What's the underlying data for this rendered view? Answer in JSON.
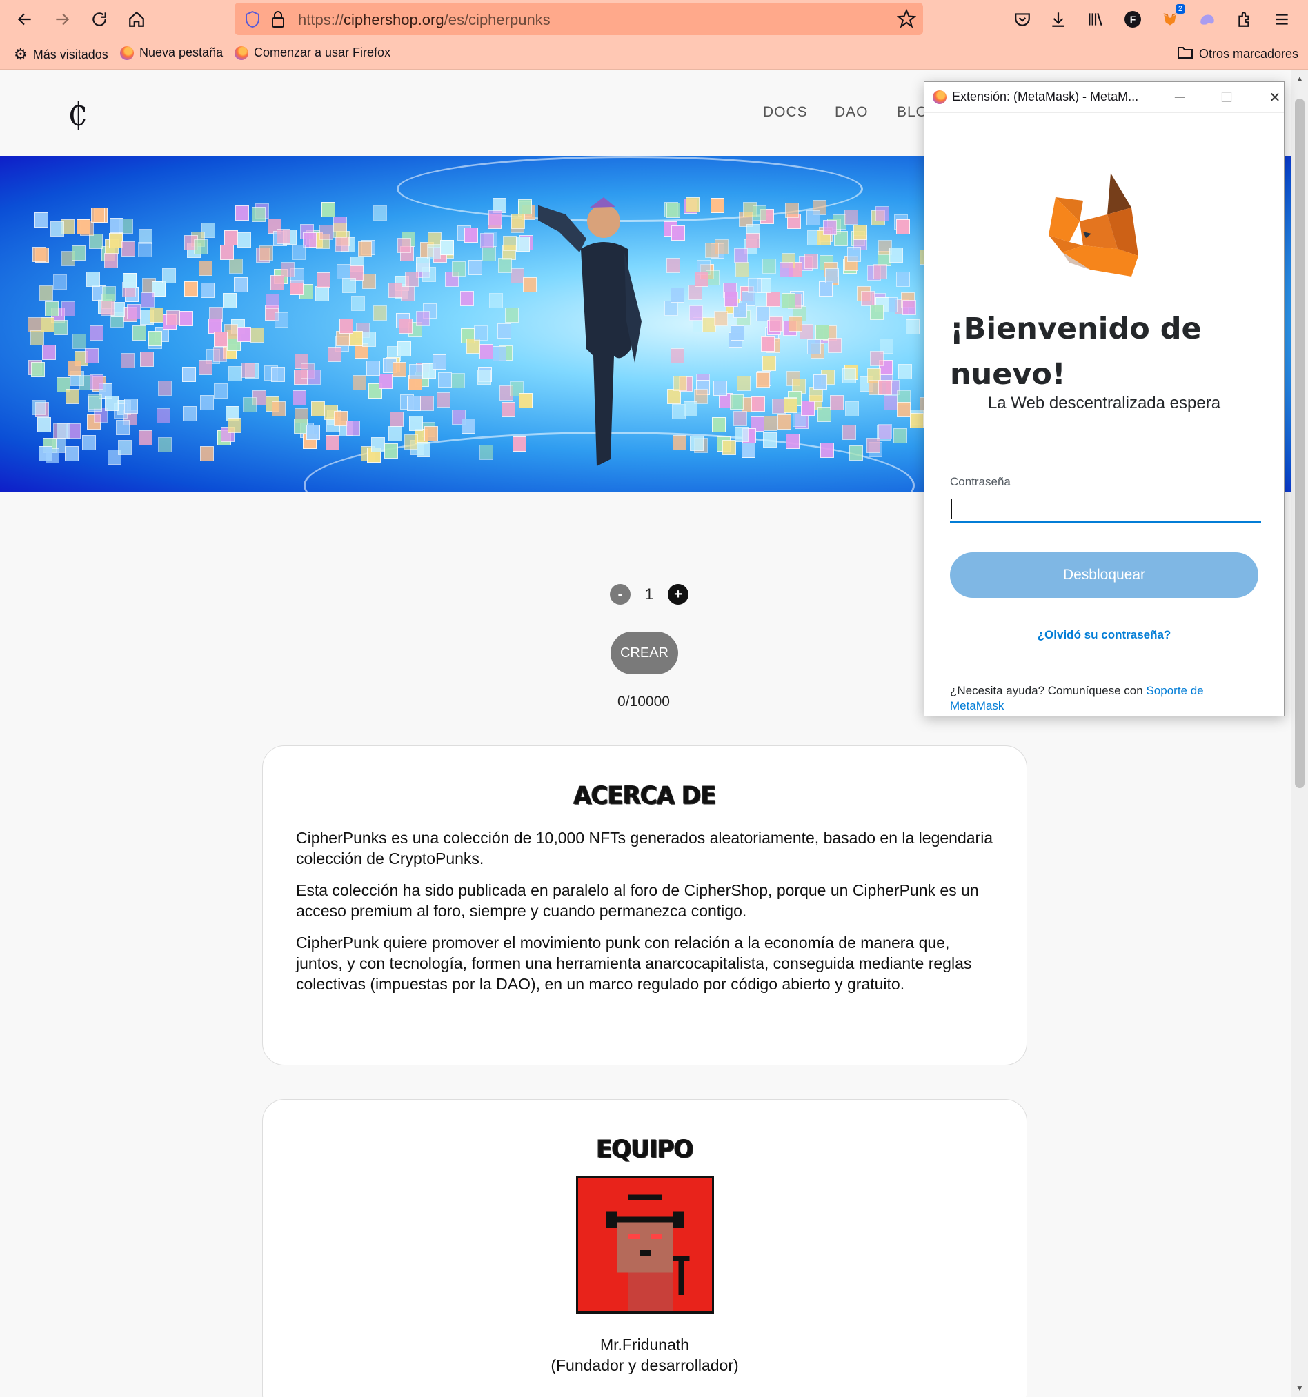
{
  "browser": {
    "url_prefix": "https://",
    "url_domain": "ciphershop.org",
    "url_path": "/es/cipherpunks",
    "extension_badge": "2",
    "account_initial": "F",
    "bookmarks": [
      {
        "label": "Más visitados",
        "icon": "gear-icon"
      },
      {
        "label": "Nueva pestaña",
        "icon": "firefox-icon"
      },
      {
        "label": "Comenzar a usar Firefox",
        "icon": "firefox-icon"
      }
    ],
    "other_bookmarks": "Otros marcadores"
  },
  "site": {
    "logo": "₵",
    "nav": [
      "DOCS",
      "DAO",
      "BLO"
    ]
  },
  "mint": {
    "minus": "-",
    "plus": "+",
    "quantity": "1",
    "button": "CREAR",
    "supply": "0/10000"
  },
  "about": {
    "title": "ACERCA DE",
    "paragraphs": [
      "CipherPunks es una colección de 10,000 NFTs generados aleatoriamente, basado en la legendaria colección de CryptoPunks.",
      "Esta colección ha sido publicada en paralelo al foro de CipherShop, porque un CipherPunk es un acceso premium al foro, siempre y cuando permanezca contigo.",
      "CipherPunk quiere promover el movimiento punk con relación a la economía de manera que, juntos, y con tecnología, formen una herramienta anarcocapitalista, conseguida mediante reglas colectivas (impuestas por la DAO), en un marco regulado por código abierto y gratuito."
    ]
  },
  "team": {
    "title": "EQUIPO",
    "member_name": "Mr.Fridunath",
    "member_role": "(Fundador y desarrollador)"
  },
  "metamask": {
    "window_title": "Extensión: (MetaMask) - MetaM...",
    "heading_line1": "¡Bienvenido de",
    "heading_line2": "nuevo!",
    "subtitle": "La Web descentralizada espera",
    "password_label": "Contraseña",
    "password_value": "",
    "unlock_button": "Desbloquear",
    "forgot_link": "¿Olvidó su contraseña?",
    "help_text": "¿Necesita ayuda? Comuníquese con ",
    "help_link": "Soporte de MetaMask"
  },
  "colors": {
    "toolbar": "#ffc8b4",
    "urlbar": "#ffa98b",
    "metamask_blue": "#037dd6",
    "unlock_disabled": "#7fb7e4",
    "avatar_bg": "#e8231b"
  }
}
